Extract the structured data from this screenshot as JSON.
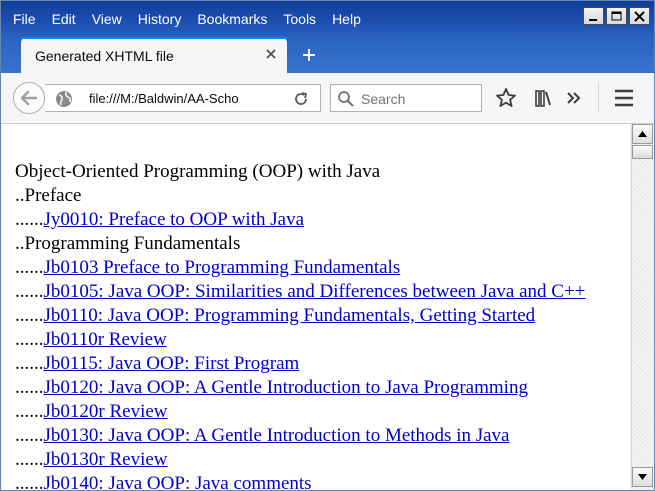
{
  "menu": [
    "File",
    "Edit",
    "View",
    "History",
    "Bookmarks",
    "Tools",
    "Help"
  ],
  "tab": {
    "title": "Generated XHTML file"
  },
  "nav": {
    "url": "file:///M:/Baldwin/AA-Scho",
    "search_placeholder": "Search"
  },
  "content": {
    "lines": [
      {
        "prefix": "",
        "text": "Object-Oriented Programming (OOP) with Java",
        "link": false
      },
      {
        "prefix": "..",
        "text": "Preface",
        "link": false
      },
      {
        "prefix": "......",
        "text": "Jy0010: Preface to OOP with Java",
        "link": true
      },
      {
        "prefix": "..",
        "text": "Programming Fundamentals",
        "link": false
      },
      {
        "prefix": "......",
        "text": "Jb0103 Preface to Programming Fundamentals",
        "link": true
      },
      {
        "prefix": "......",
        "text": "Jb0105: Java OOP: Similarities and Differences between Java and C++",
        "link": true
      },
      {
        "prefix": "......",
        "text": "Jb0110: Java OOP: Programming Fundamentals, Getting Started",
        "link": true
      },
      {
        "prefix": "......",
        "text": "Jb0110r Review",
        "link": true
      },
      {
        "prefix": "......",
        "text": "Jb0115: Java OOP: First Program",
        "link": true
      },
      {
        "prefix": "......",
        "text": "Jb0120: Java OOP: A Gentle Introduction to Java Programming",
        "link": true
      },
      {
        "prefix": "......",
        "text": "Jb0120r Review",
        "link": true
      },
      {
        "prefix": "......",
        "text": "Jb0130: Java OOP: A Gentle Introduction to Methods in Java",
        "link": true
      },
      {
        "prefix": "......",
        "text": "Jb0130r Review",
        "link": true
      },
      {
        "prefix": "......",
        "text": "Jb0140: Java OOP: Java comments",
        "link": true
      }
    ]
  },
  "icons": {
    "tab_close": "close-icon",
    "new_tab": "plus-icon",
    "back": "back-arrow-icon",
    "site": "globe-icon",
    "reload": "reload-icon",
    "search": "search-icon",
    "bookmark": "star-icon",
    "library": "library-icon",
    "overflow": "chevron-double-right-icon",
    "menu": "hamburger-menu-icon"
  }
}
